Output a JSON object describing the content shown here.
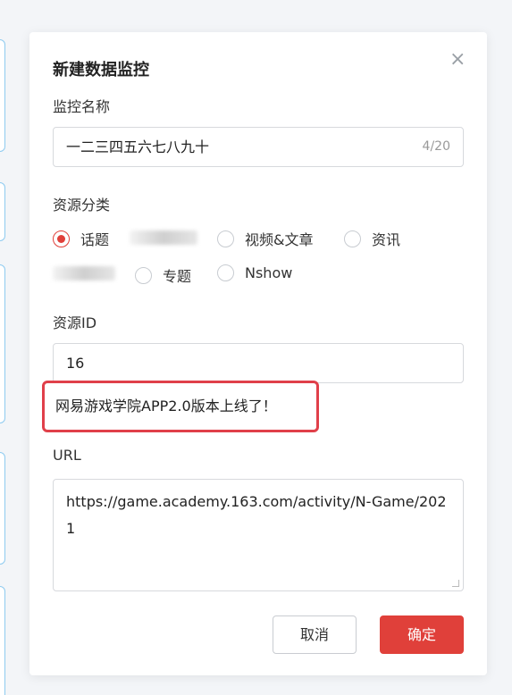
{
  "dialog": {
    "title": "新建数据监控",
    "close_icon": "×",
    "name_label": "监控名称",
    "name_value": "一二三四五六七八九十",
    "name_counter": "4/20",
    "category_label": "资源分类",
    "categories": [
      {
        "label": "话题",
        "checked": true
      },
      {
        "label": "视频&文章",
        "checked": false
      },
      {
        "label": "资讯",
        "checked": false
      },
      {
        "label": "专题",
        "checked": false
      },
      {
        "label": "Nshow",
        "checked": false
      }
    ],
    "resource_id_label": "资源ID",
    "resource_id_value": "16",
    "resource_tip": "网易游戏学院APP2.0版本上线了！",
    "url_label": "URL",
    "url_value": "https://game.academy.163.com/activity/N-Game/2021",
    "cancel_label": "取消",
    "confirm_label": "确定"
  },
  "colors": {
    "accent": "#e0403a",
    "highlight_border": "#e0404a",
    "background_card_border": "#8ecbf0"
  }
}
